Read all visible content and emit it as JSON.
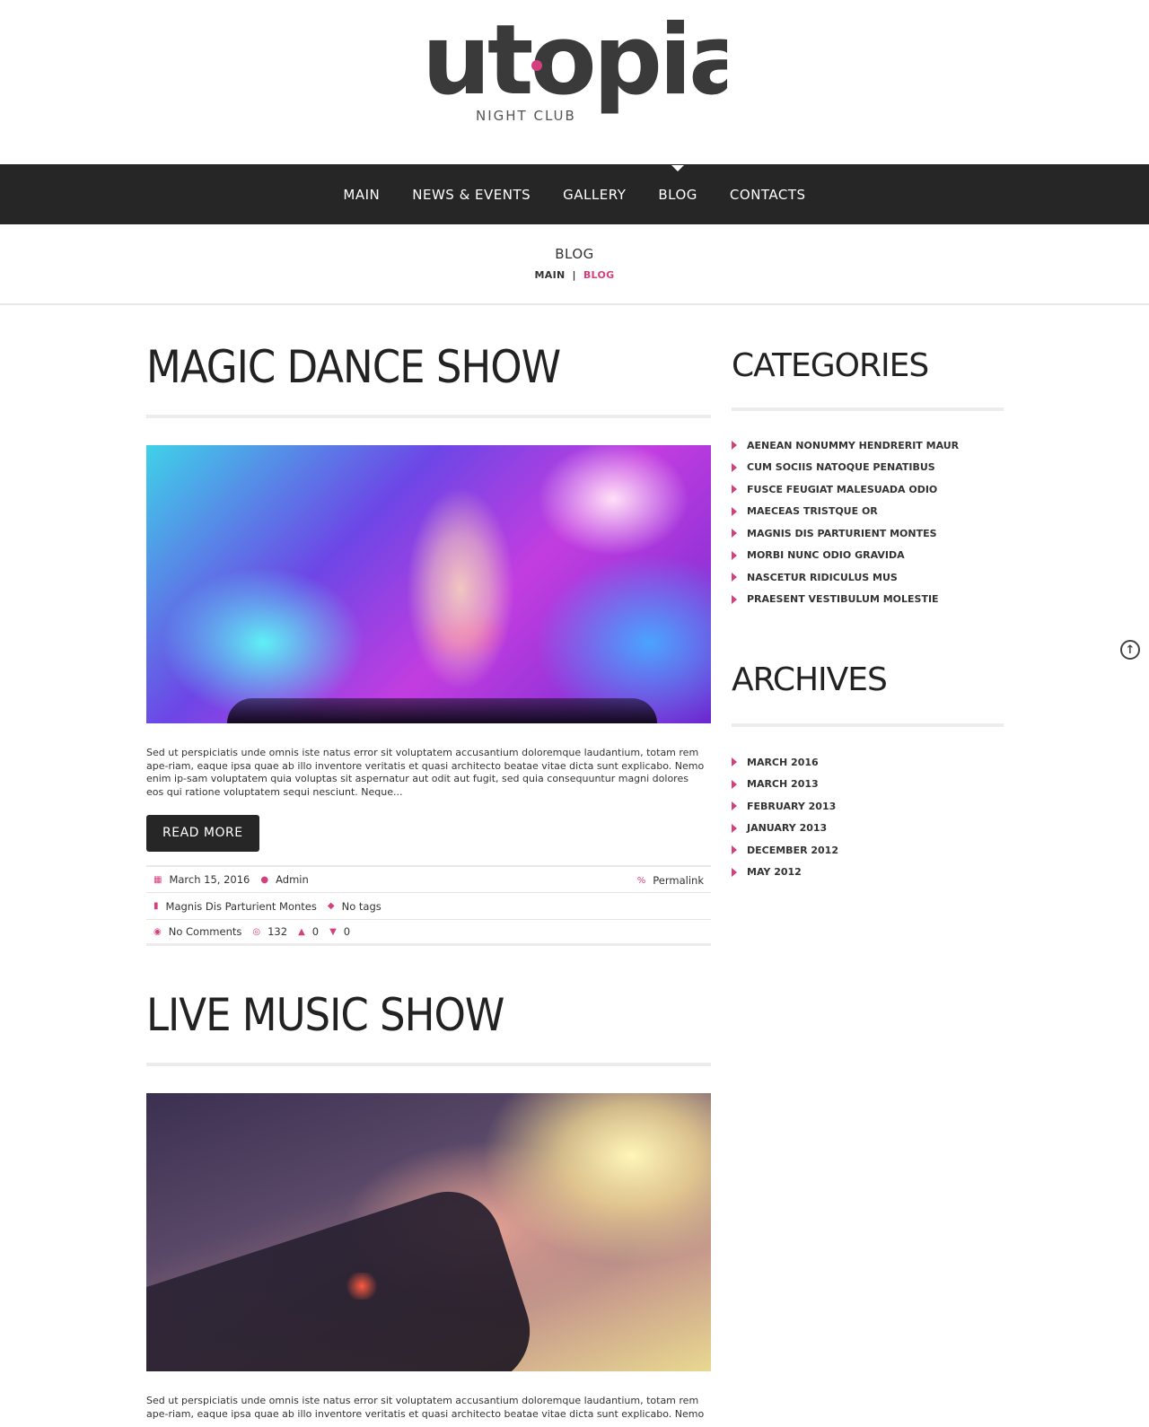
{
  "brand": {
    "name": "utopia",
    "tagline": "NIGHT CLUB",
    "accent": "#d43f7d",
    "dark": "#262626"
  },
  "nav": {
    "items": [
      {
        "label": "MAIN"
      },
      {
        "label": "NEWS & EVENTS"
      },
      {
        "label": "GALLERY"
      },
      {
        "label": "BLOG",
        "active": true
      },
      {
        "label": "CONTACTS"
      }
    ]
  },
  "breadcrumb": {
    "title": "BLOG",
    "home": "MAIN",
    "separator": "|",
    "current": "BLOG"
  },
  "posts": [
    {
      "title": "MAGIC DANCE SHOW",
      "excerpt": "Sed ut perspiciatis unde omnis iste natus error sit voluptatem accusantium doloremque laudantium, totam rem ape-riam, eaque ipsa quae ab illo inventore veritatis et quasi architecto beatae vitae dicta sunt explicabo. Nemo enim ip-sam voluptatem quia voluptas sit aspernatur aut odit aut fugit, sed quia consequuntur magni dolores eos qui ratione voluptatem sequi nesciunt. Neque...",
      "read_more": "READ MORE",
      "date": "March 15, 2016",
      "author": "Admin",
      "permalink": "Permalink",
      "category": "Magnis Dis Parturient Montes",
      "tags": "No tags",
      "comments": "No Comments",
      "views": "132",
      "likes": "0",
      "dislikes": "0"
    },
    {
      "title": "LIVE MUSIC SHOW",
      "excerpt": "Sed ut perspiciatis unde omnis iste natus error sit voluptatem accusantium doloremque laudantium, totam rem ape-riam, eaque ipsa quae ab illo inventore veritatis et quasi architecto beatae vitae dicta sunt explicabo. Nemo enim ip-"
    }
  ],
  "sidebar": {
    "categories_title": "CATEGORIES",
    "categories": [
      "AENEAN NONUMMY HENDRERIT MAUR",
      "CUM SOCIIS NATOQUE PENATIBUS",
      "FUSCE FEUGIAT MALESUADA ODIO",
      "MAECEAS TRISTQUE OR",
      "MAGNIS DIS PARTURIENT MONTES",
      "MORBI NUNC ODIO GRAVIDA",
      "NASCETUR RIDICULUS MUS",
      "PRAESENT VESTIBULUM MOLESTIE"
    ],
    "archives_title": "ARCHIVES",
    "archives": [
      "MARCH 2016",
      "MARCH 2013",
      "FEBRUARY 2013",
      "JANUARY 2013",
      "DECEMBER 2012",
      "MAY 2012"
    ]
  },
  "icons": {
    "calendar": "calendar-icon",
    "user": "user-icon",
    "link": "link-icon",
    "bookmark": "bookmark-icon",
    "tag": "tag-icon",
    "comment": "comment-icon",
    "eye": "eye-icon",
    "thumbs_up": "thumbs-up-icon",
    "thumbs_down": "thumbs-down-icon",
    "scroll_top": "arrow-up-circle-icon"
  }
}
